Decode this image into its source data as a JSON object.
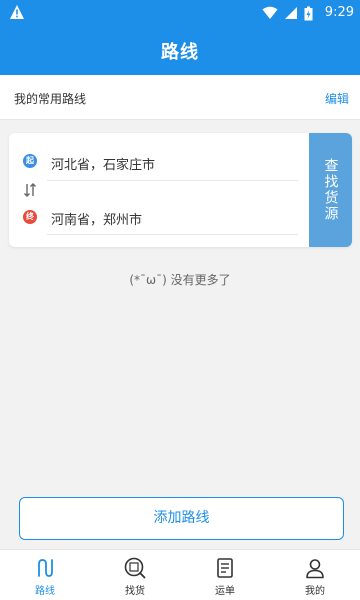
{
  "status_bar": {
    "time": "9:29"
  },
  "header": {
    "title": "路线"
  },
  "section": {
    "title": "我的常用路线",
    "edit_label": "编辑"
  },
  "route": {
    "start_badge": "起",
    "end_badge": "终",
    "start_place": "河北省，石家庄市",
    "end_place": "河南省，郑州市",
    "search_label": "查找货源"
  },
  "no_more_text": "(*¯ω¯) 没有更多了",
  "add_route_label": "添加路线",
  "tabs": [
    {
      "label": "路线",
      "icon": "route-icon",
      "active": true
    },
    {
      "label": "找货",
      "icon": "find-goods-icon",
      "active": false
    },
    {
      "label": "运单",
      "icon": "waybill-icon",
      "active": false
    },
    {
      "label": "我的",
      "icon": "profile-icon",
      "active": false
    }
  ],
  "colors": {
    "primary": "#1e8fe8",
    "search_button": "#5aa3dc",
    "start": "#3a8ee6",
    "end": "#e64b3c"
  }
}
